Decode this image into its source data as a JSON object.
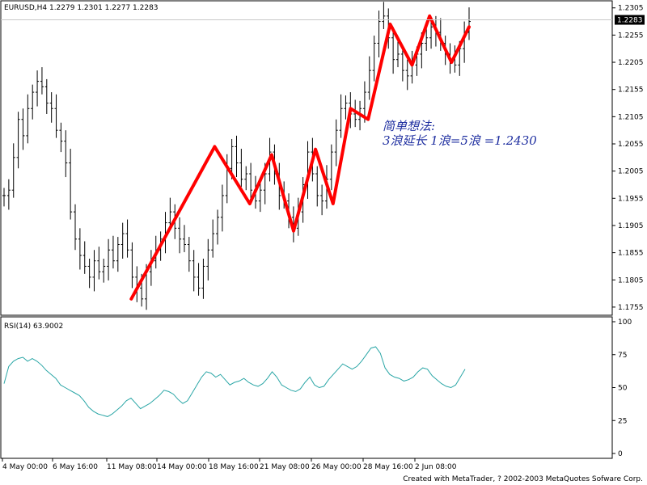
{
  "window": {
    "symbol_header": "EURUSD,H4  1.2279  1.2301  1.2277  1.2283",
    "footer_credit": "Created with MetaTrader, ? 2002-2003 MetaQuotes Sofware Corp."
  },
  "annotation": {
    "line1": "简单想法:",
    "line2": "3浪延长  1浪=5浪  =1.2430"
  },
  "colors": {
    "candles": "#000000",
    "wave_line": "#ff0000",
    "rsi_line": "#2aa6a6",
    "annotation": "#1f2fa0",
    "price_marker_bg": "#000000"
  },
  "chart_data": [
    {
      "type": "ohlc",
      "title": "EURUSD,H4",
      "current_price": "1.2283",
      "ylim": [
        1.174,
        1.2318
      ],
      "y_ticks": [
        "1.2305",
        "1.2255",
        "1.2205",
        "1.2155",
        "1.2105",
        "1.2055",
        "1.2005",
        "1.1955",
        "1.1905",
        "1.1855",
        "1.1805",
        "1.1755"
      ],
      "x_ticks": [
        "4 May 00:00",
        "6 May 16:00",
        "11 May 08:00",
        "14 May 00:00",
        "18 May 16:00",
        "21 May 08:00",
        "26 May 00:00",
        "28 May 16:00",
        "2 Jun 08:00"
      ],
      "grid": false,
      "close": [
        1.196,
        1.197,
        1.203,
        1.21,
        1.207,
        1.212,
        1.215,
        1.217,
        1.216,
        1.213,
        1.212,
        1.208,
        1.206,
        1.202,
        1.193,
        1.188,
        1.185,
        1.183,
        1.181,
        1.184,
        1.182,
        1.183,
        1.186,
        1.184,
        1.187,
        1.189,
        1.186,
        1.181,
        1.179,
        1.177,
        1.182,
        1.184,
        1.186,
        1.188,
        1.191,
        1.193,
        1.19,
        1.188,
        1.187,
        1.184,
        1.181,
        1.179,
        1.183,
        1.186,
        1.189,
        1.192,
        1.196,
        1.201,
        1.205,
        1.202,
        1.199,
        1.2,
        1.197,
        1.195,
        1.197,
        1.2,
        1.204,
        1.2,
        1.196,
        1.195,
        1.192,
        1.19,
        1.193,
        1.198,
        1.204,
        1.2,
        1.196,
        1.195,
        1.199,
        1.204,
        1.208,
        1.212,
        1.213,
        1.211,
        1.21,
        1.212,
        1.215,
        1.219,
        1.224,
        1.228,
        1.229,
        1.225,
        1.221,
        1.222,
        1.219,
        1.218,
        1.22,
        1.222,
        1.224,
        1.225,
        1.227,
        1.226,
        1.224,
        1.222,
        1.221,
        1.22,
        1.223,
        1.226,
        1.228
      ]
    },
    {
      "type": "line",
      "title": "RSI(14)  63.9002",
      "ylim": [
        0,
        100
      ],
      "y_ticks": [
        "100",
        "75",
        "50",
        "25",
        "0"
      ],
      "values": [
        53,
        66,
        70,
        72,
        73,
        70,
        72,
        70,
        67,
        63,
        60,
        57,
        52,
        50,
        48,
        46,
        44,
        40,
        35,
        32,
        30,
        29,
        28,
        30,
        33,
        36,
        40,
        42,
        38,
        34,
        36,
        38,
        41,
        44,
        48,
        47,
        45,
        41,
        38,
        40,
        46,
        52,
        58,
        62,
        61,
        58,
        60,
        56,
        52,
        54,
        55,
        57,
        54,
        52,
        51,
        53,
        57,
        62,
        58,
        52,
        50,
        48,
        47,
        49,
        54,
        58,
        52,
        50,
        51,
        56,
        60,
        64,
        68,
        66,
        64,
        66,
        70,
        75,
        80,
        81,
        76,
        65,
        60,
        58,
        57,
        55,
        56,
        58,
        62,
        65,
        64,
        59,
        56,
        53,
        51,
        50,
        52,
        58,
        64
      ]
    }
  ]
}
